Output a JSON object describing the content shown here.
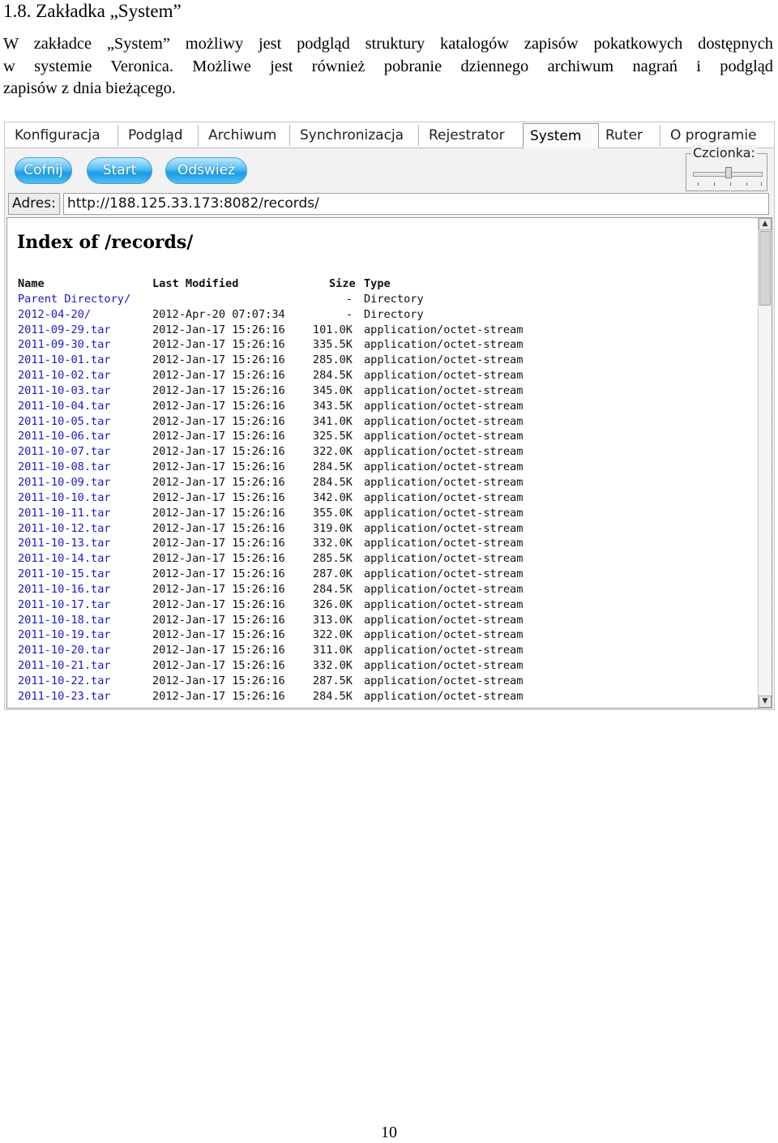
{
  "document": {
    "heading": "1.8. Zakładka „System”",
    "paragraph_lines": [
      "W zakładce „System” możliwy jest podgląd struktury katalogów zapisów pokatkowych dostępnych",
      "w systemie Veronica. Możliwe jest również pobranie dziennego archiwum nagrań i podgląd",
      "zapisów z dnia bieżącego."
    ],
    "page_number": "10"
  },
  "app": {
    "tabs": [
      {
        "label": "Konfiguracja"
      },
      {
        "label": "Podgląd"
      },
      {
        "label": "Archiwum"
      },
      {
        "label": "Synchronizacja"
      },
      {
        "label": "Rejestrator"
      },
      {
        "label": "System",
        "active": true
      },
      {
        "label": "Ruter"
      },
      {
        "label": "O programie"
      }
    ],
    "buttons": {
      "back": "Cofnij",
      "start": "Start",
      "refresh": "Odśwież"
    },
    "font_size_label": "Czcionka:",
    "address_label": "Adres:",
    "address_value": "http://188.125.33.173:8082/records/",
    "accent_button_color": "#1a9ce3",
    "link_color": "#1a1ac8"
  },
  "listing": {
    "title": "Index of /records/",
    "columns": {
      "name": "Name",
      "last_modified": "Last Modified",
      "size": "Size",
      "type": "Type"
    },
    "rows": [
      {
        "name": "Parent Directory/",
        "modified": "",
        "size": "-",
        "type": "Directory"
      },
      {
        "name": "2012-04-20/",
        "modified": "2012-Apr-20 07:07:34",
        "size": "-",
        "type": "Directory"
      },
      {
        "name": "2011-09-29.tar",
        "modified": "2012-Jan-17 15:26:16",
        "size": "101.0K",
        "type": "application/octet-stream"
      },
      {
        "name": "2011-09-30.tar",
        "modified": "2012-Jan-17 15:26:16",
        "size": "335.5K",
        "type": "application/octet-stream"
      },
      {
        "name": "2011-10-01.tar",
        "modified": "2012-Jan-17 15:26:16",
        "size": "285.0K",
        "type": "application/octet-stream"
      },
      {
        "name": "2011-10-02.tar",
        "modified": "2012-Jan-17 15:26:16",
        "size": "284.5K",
        "type": "application/octet-stream"
      },
      {
        "name": "2011-10-03.tar",
        "modified": "2012-Jan-17 15:26:16",
        "size": "345.0K",
        "type": "application/octet-stream"
      },
      {
        "name": "2011-10-04.tar",
        "modified": "2012-Jan-17 15:26:16",
        "size": "343.5K",
        "type": "application/octet-stream"
      },
      {
        "name": "2011-10-05.tar",
        "modified": "2012-Jan-17 15:26:16",
        "size": "341.0K",
        "type": "application/octet-stream"
      },
      {
        "name": "2011-10-06.tar",
        "modified": "2012-Jan-17 15:26:16",
        "size": "325.5K",
        "type": "application/octet-stream"
      },
      {
        "name": "2011-10-07.tar",
        "modified": "2012-Jan-17 15:26:16",
        "size": "322.0K",
        "type": "application/octet-stream"
      },
      {
        "name": "2011-10-08.tar",
        "modified": "2012-Jan-17 15:26:16",
        "size": "284.5K",
        "type": "application/octet-stream"
      },
      {
        "name": "2011-10-09.tar",
        "modified": "2012-Jan-17 15:26:16",
        "size": "284.5K",
        "type": "application/octet-stream"
      },
      {
        "name": "2011-10-10.tar",
        "modified": "2012-Jan-17 15:26:16",
        "size": "342.0K",
        "type": "application/octet-stream"
      },
      {
        "name": "2011-10-11.tar",
        "modified": "2012-Jan-17 15:26:16",
        "size": "355.0K",
        "type": "application/octet-stream"
      },
      {
        "name": "2011-10-12.tar",
        "modified": "2012-Jan-17 15:26:16",
        "size": "319.0K",
        "type": "application/octet-stream"
      },
      {
        "name": "2011-10-13.tar",
        "modified": "2012-Jan-17 15:26:16",
        "size": "332.0K",
        "type": "application/octet-stream"
      },
      {
        "name": "2011-10-14.tar",
        "modified": "2012-Jan-17 15:26:16",
        "size": "285.5K",
        "type": "application/octet-stream"
      },
      {
        "name": "2011-10-15.tar",
        "modified": "2012-Jan-17 15:26:16",
        "size": "287.0K",
        "type": "application/octet-stream"
      },
      {
        "name": "2011-10-16.tar",
        "modified": "2012-Jan-17 15:26:16",
        "size": "284.5K",
        "type": "application/octet-stream"
      },
      {
        "name": "2011-10-17.tar",
        "modified": "2012-Jan-17 15:26:16",
        "size": "326.0K",
        "type": "application/octet-stream"
      },
      {
        "name": "2011-10-18.tar",
        "modified": "2012-Jan-17 15:26:16",
        "size": "313.0K",
        "type": "application/octet-stream"
      },
      {
        "name": "2011-10-19.tar",
        "modified": "2012-Jan-17 15:26:16",
        "size": "322.0K",
        "type": "application/octet-stream"
      },
      {
        "name": "2011-10-20.tar",
        "modified": "2012-Jan-17 15:26:16",
        "size": "311.0K",
        "type": "application/octet-stream"
      },
      {
        "name": "2011-10-21.tar",
        "modified": "2012-Jan-17 15:26:16",
        "size": "332.0K",
        "type": "application/octet-stream"
      },
      {
        "name": "2011-10-22.tar",
        "modified": "2012-Jan-17 15:26:16",
        "size": "287.5K",
        "type": "application/octet-stream"
      },
      {
        "name": "2011-10-23.tar",
        "modified": "2012-Jan-17 15:26:16",
        "size": "284.5K",
        "type": "application/octet-stream"
      }
    ]
  }
}
